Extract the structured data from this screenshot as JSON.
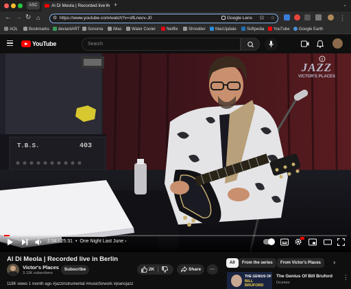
{
  "browser": {
    "tabs": [
      {
        "label": "ASC"
      },
      {
        "label": "Al Di Meola | Recorded live in"
      }
    ],
    "url": "https://www.youtube.com/watch?v=sflLnecv-J0",
    "lens_label": "Google Lens",
    "bookmarks": [
      "AOL",
      "Bookmarks",
      "deviantART",
      "Sonoma",
      "iMac",
      "Water Cooler",
      "Netflix",
      "Shredder",
      "MacUpdate",
      "Softpedia",
      "YouTube",
      "Google Earth"
    ]
  },
  "youtube": {
    "logo_text": "YouTube",
    "search_placeholder": "Search"
  },
  "video": {
    "overlay_logo_main": "JAZZ",
    "overlay_logo_sub": "VICTOR'S PLACES",
    "amp_label": "T.B.S.",
    "amp_number": "403",
    "progress_percent": 1.5,
    "time_display": "2:34 / 25:31",
    "chapter": "One Night Last June",
    "chapter_chevron": "›"
  },
  "info": {
    "title": "Al Di Meola | Recorded live in Berlin",
    "channel_name": "Victor's Places",
    "subscribers": "3.13K subscribers",
    "subscribe_label": "Subscribe",
    "like_count": "2K",
    "share_label": "Share",
    "more_label": "···",
    "description": "118K views  1 month ago  #jazzinstrumental #musicforwork #pianojazz"
  },
  "recommendations": {
    "chips": [
      "All",
      "From the series",
      "From Victor's Places"
    ],
    "chip_next": "›",
    "first_title": "The Genius Of Bill Bruford",
    "first_channel": "Drumeo",
    "thumb_text_1": "THE GENIUS OF",
    "thumb_text_2": "BILL BRUFORD"
  },
  "colors": {
    "accent_red": "#ff0000",
    "omnibox_focus": "#8ab4f8",
    "page_bg": "#0f0f0f"
  }
}
